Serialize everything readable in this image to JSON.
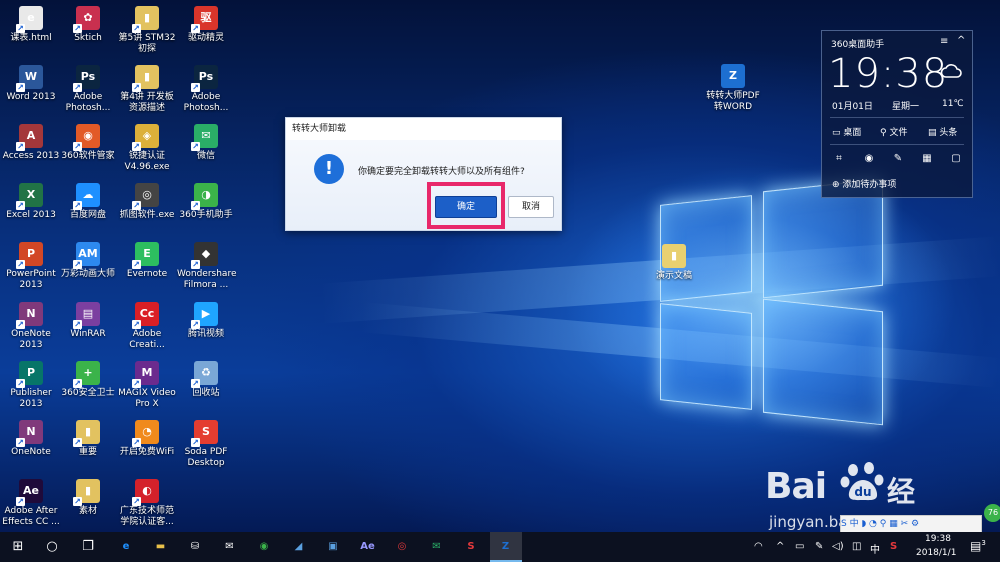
{
  "desktop_icons": [
    {
      "label": "课表.html",
      "glyph": "e",
      "color": "#e9e9e9"
    },
    {
      "label": "Sktich",
      "glyph": "✿",
      "color": "#c9304f"
    },
    {
      "label": "第5讲 STM32初探",
      "glyph": "▮",
      "color": "#e2c260"
    },
    {
      "label": "驱动精灵",
      "glyph": "驱",
      "color": "#d9352b"
    },
    {
      "label": "Word 2013",
      "glyph": "W",
      "color": "#2b579a"
    },
    {
      "label": "Adobe Photosh...",
      "glyph": "Ps",
      "color": "#0b2540"
    },
    {
      "label": "第4讲 开发板资源描述",
      "glyph": "▮",
      "color": "#e2c260"
    },
    {
      "label": "Adobe Photosh...",
      "glyph": "Ps",
      "color": "#0b2540"
    },
    {
      "label": "Access 2013",
      "glyph": "A",
      "color": "#a4373a"
    },
    {
      "label": "360软件管家",
      "glyph": "◉",
      "color": "#e25a27"
    },
    {
      "label": "锐捷认证V4.96.exe",
      "glyph": "◈",
      "color": "#dcb03a"
    },
    {
      "label": "微信",
      "glyph": "✉",
      "color": "#2aae67"
    },
    {
      "label": "Excel 2013",
      "glyph": "X",
      "color": "#217346"
    },
    {
      "label": "百度网盘",
      "glyph": "☁",
      "color": "#1e90ff"
    },
    {
      "label": "抓图软件.exe",
      "glyph": "◎",
      "color": "#444"
    },
    {
      "label": "360手机助手",
      "glyph": "◑",
      "color": "#3bb34a"
    },
    {
      "label": "PowerPoint 2013",
      "glyph": "P",
      "color": "#d24726"
    },
    {
      "label": "万彩动画大师",
      "glyph": "AM",
      "color": "#2d89ef"
    },
    {
      "label": "Evernote",
      "glyph": "E",
      "color": "#2dbe60"
    },
    {
      "label": "Wondershare Filmora ...",
      "glyph": "◆",
      "color": "#333"
    },
    {
      "label": "OneNote 2013",
      "glyph": "N",
      "color": "#80397b"
    },
    {
      "label": "WinRAR",
      "glyph": "▤",
      "color": "#7b3fa0"
    },
    {
      "label": "Adobe Creati...",
      "glyph": "Cc",
      "color": "#da1f26"
    },
    {
      "label": "腾讯视频",
      "glyph": "▶",
      "color": "#1fa5ff"
    },
    {
      "label": "Publisher 2013",
      "glyph": "P",
      "color": "#077568"
    },
    {
      "label": "360安全卫士",
      "glyph": "+",
      "color": "#3bb34a"
    },
    {
      "label": "MAGIX Video Pro X",
      "glyph": "M",
      "color": "#6b2b8e"
    },
    {
      "label": "回收站",
      "glyph": "♻",
      "color": "#7aa7d6"
    },
    {
      "label": "OneNote",
      "glyph": "N",
      "color": "#80397b"
    },
    {
      "label": "重要",
      "glyph": "▮",
      "color": "#e2c260"
    },
    {
      "label": "开启免费WiFi",
      "glyph": "◔",
      "color": "#f08a1c"
    },
    {
      "label": "Soda PDF Desktop",
      "glyph": "S",
      "color": "#e43d30"
    },
    {
      "label": "Adobe After Effects CC ...",
      "glyph": "Ae",
      "color": "#1f0a3a"
    },
    {
      "label": "素材",
      "glyph": "▮",
      "color": "#e2c260"
    },
    {
      "label": "广东技术师范学院认证客...",
      "glyph": "◐",
      "color": "#d4212b"
    }
  ],
  "extra_icons": [
    {
      "label": "转转大师PDF转WORD",
      "glyph": "Z",
      "color": "#1d6fd1"
    },
    {
      "label": "演示文稿",
      "glyph": "▮",
      "color": "#e8d070"
    }
  ],
  "dialog": {
    "title": "转转大师卸载",
    "icon": "!",
    "message": "你确定要完全卸载转转大师以及所有组件?",
    "ok_label": "确定",
    "cancel_label": "取消"
  },
  "widget": {
    "title": "360桌面助手",
    "menu_icon": "≡",
    "collapse_icon": "^",
    "time": "19:38",
    "date": "01月01日",
    "weekday": "星期一",
    "temperature": "11℃",
    "links": [
      {
        "icon": "▭",
        "label": "桌面"
      },
      {
        "icon": "⚲",
        "label": "文件"
      },
      {
        "icon": "▤",
        "label": "头条"
      }
    ],
    "tools": [
      "⌗",
      "◉",
      "✎",
      "▦",
      "▢"
    ],
    "add_todo": "添加待办事项"
  },
  "taskbar": {
    "start_icon": "⊞",
    "search_icon": "○",
    "taskview_icon": "❐",
    "apps": [
      {
        "glyph": "e",
        "color": "#1e90ff",
        "name": "edge-icon"
      },
      {
        "glyph": "▬",
        "color": "#e8c04a",
        "name": "file-explorer-icon"
      },
      {
        "glyph": "⛁",
        "color": "#ffffff",
        "name": "store-icon"
      },
      {
        "glyph": "✉",
        "color": "#ffffff",
        "name": "mail-icon"
      },
      {
        "glyph": "◉",
        "color": "#3bb34a",
        "name": "360-browser-icon"
      },
      {
        "glyph": "◢",
        "color": "#5aa0e0",
        "name": "network-tool-icon"
      },
      {
        "glyph": "▣",
        "color": "#5aa0e0",
        "name": "screenshot-tool-icon"
      },
      {
        "glyph": "Ae",
        "color": "#9999ff",
        "name": "after-effects-icon"
      },
      {
        "glyph": "◎",
        "color": "#e4393c",
        "name": "netease-music-icon"
      },
      {
        "glyph": "✉",
        "color": "#2aae67",
        "name": "wechat-icon"
      },
      {
        "glyph": "S",
        "color": "#e4393c",
        "name": "sogou-icon"
      },
      {
        "glyph": "Z",
        "color": "#1d6fd1",
        "name": "zhuanzhuan-icon"
      }
    ],
    "tray": {
      "wifi": "◠",
      "chevron": "^",
      "volume": "◁)",
      "input": "中",
      "sogou": "S"
    },
    "clock_time": "19:38",
    "clock_date": "2018/1/1",
    "notification_icon": "▤",
    "notification_count": "3"
  },
  "watermark": {
    "brand": "Bai",
    "brand2": "经验",
    "url": "jingyan.baidu.com"
  },
  "ime_bar": "S 中 ◗ ◔ ⚲ ▦ ✂ ⚙",
  "badge": "76"
}
